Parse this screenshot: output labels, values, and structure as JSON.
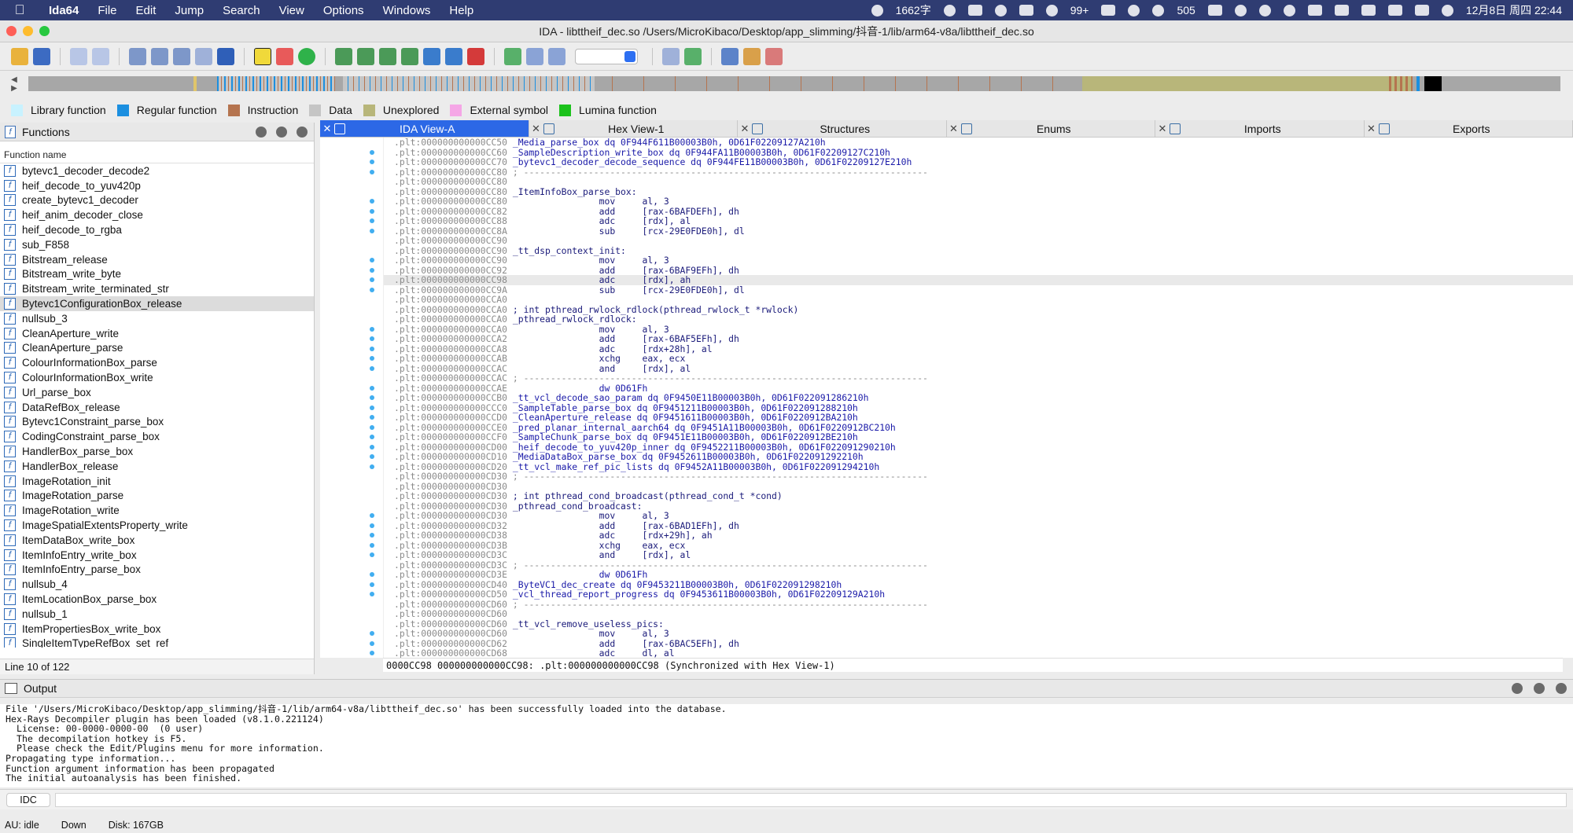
{
  "menubar": {
    "app": "Ida64",
    "items": [
      "File",
      "Edit",
      "Jump",
      "Search",
      "View",
      "Options",
      "Windows",
      "Help"
    ],
    "status": {
      "chars": "1662字",
      "notifications": "99+",
      "count": "505",
      "datetime": "12月8日 周四  22:44"
    }
  },
  "window": {
    "title": "IDA - libttheif_dec.so /Users/MicroKibaco/Desktop/app_slimming/抖音-1/lib/arm64-v8a/libttheif_dec.so"
  },
  "legend": [
    {
      "label": "Library function",
      "color": "#c8f2ff"
    },
    {
      "label": "Regular function",
      "color": "#1b8fe0"
    },
    {
      "label": "Instruction",
      "color": "#b5744f"
    },
    {
      "label": "Data",
      "color": "#c5c5c5"
    },
    {
      "label": "Unexplored",
      "color": "#b8b67a"
    },
    {
      "label": "External symbol",
      "color": "#f5a6e6"
    },
    {
      "label": "Lumina function",
      "color": "#1cc21c"
    }
  ],
  "functions": {
    "title": "Functions",
    "column": "Function name",
    "items": [
      "bytevc1_decoder_decode2",
      "heif_decode_to_yuv420p",
      "create_bytevc1_decoder",
      "heif_anim_decoder_close",
      "heif_decode_to_rgba",
      "sub_F858",
      "Bitstream_release",
      "Bitstream_write_byte",
      "Bitstream_write_terminated_str",
      "Bytevc1ConfigurationBox_release",
      "nullsub_3",
      "CleanAperture_write",
      "CleanAperture_parse",
      "ColourInformationBox_parse",
      "ColourInformationBox_write",
      "Url_parse_box",
      "DataRefBox_release",
      "Bytevc1Constraint_parse_box",
      "CodingConstraint_parse_box",
      "HandlerBox_parse_box",
      "HandlerBox_release",
      "ImageRotation_init",
      "ImageRotation_parse",
      "ImageRotation_write",
      "ImageSpatialExtentsProperty_write",
      "ItemDataBox_write_box",
      "ItemInfoEntry_write_box",
      "ItemInfoEntry_parse_box",
      "nullsub_4",
      "ItemLocationBox_parse_box",
      "nullsub_1",
      "ItemPropertiesBox_write_box",
      "SingleItemTypeRefBox_set_ref"
    ],
    "selected_index": 9,
    "footer": "Line 10 of 122"
  },
  "tabs": [
    {
      "label": "IDA View-A",
      "active": true
    },
    {
      "label": "Hex View-1",
      "active": false
    },
    {
      "label": "Structures",
      "active": false
    },
    {
      "label": "Enums",
      "active": false
    },
    {
      "label": "Imports",
      "active": false
    },
    {
      "label": "Exports",
      "active": false
    }
  ],
  "disasm": {
    "current_line": 14,
    "dot_lines": [
      1,
      2,
      3,
      6,
      7,
      8,
      9,
      12,
      13,
      14,
      15,
      19,
      20,
      21,
      22,
      23,
      25,
      26,
      27,
      28,
      29,
      30,
      31,
      32,
      33,
      38,
      39,
      40,
      41,
      42,
      44,
      45,
      46,
      50,
      51,
      52
    ],
    "lines": [
      {
        "addr": ".plt:000000000000CC50",
        "text": " _Media_parse_box dq 0F944F611B00003B0h, 0D61F02209127A210h"
      },
      {
        "addr": ".plt:000000000000CC60",
        "text": " _SampleDescription_write_box dq 0F944FA11B00003B0h, 0D61F02209127C210h"
      },
      {
        "addr": ".plt:000000000000CC70",
        "text": " _bytevc1_decoder_decode_sequence dq 0F944FE11B00003B0h, 0D61F02209127E210h"
      },
      {
        "addr": ".plt:000000000000CC80",
        "text": " ; ---------------------------------------------------------------------------"
      },
      {
        "addr": ".plt:000000000000CC80",
        "text": ""
      },
      {
        "addr": ".plt:000000000000CC80",
        "text": " _ItemInfoBox_parse_box:"
      },
      {
        "addr": ".plt:000000000000CC80",
        "text": "                 mov     al, 3"
      },
      {
        "addr": ".plt:000000000000CC82",
        "text": "                 add     [rax-6BAFDEFh], dh"
      },
      {
        "addr": ".plt:000000000000CC88",
        "text": "                 adc     [rdx], al"
      },
      {
        "addr": ".plt:000000000000CC8A",
        "text": "                 sub     [rcx-29E0FDE0h], dl"
      },
      {
        "addr": ".plt:000000000000CC90",
        "text": ""
      },
      {
        "addr": ".plt:000000000000CC90",
        "text": " _tt_dsp_context_init:"
      },
      {
        "addr": ".plt:000000000000CC90",
        "text": "                 mov     al, 3"
      },
      {
        "addr": ".plt:000000000000CC92",
        "text": "                 add     [rax-6BAF9EFh], dh"
      },
      {
        "addr": ".plt:000000000000CC98",
        "text": "                 adc     [rdx], ah"
      },
      {
        "addr": ".plt:000000000000CC9A",
        "text": "                 sub     [rcx-29E0FDE0h], dl"
      },
      {
        "addr": ".plt:000000000000CCA0",
        "text": ""
      },
      {
        "addr": ".plt:000000000000CCA0",
        "text": " ; int pthread_rwlock_rdlock(pthread_rwlock_t *rwlock)"
      },
      {
        "addr": ".plt:000000000000CCA0",
        "text": " _pthread_rwlock_rdlock:"
      },
      {
        "addr": ".plt:000000000000CCA0",
        "text": "                 mov     al, 3"
      },
      {
        "addr": ".plt:000000000000CCA2",
        "text": "                 add     [rax-6BAF5EFh], dh"
      },
      {
        "addr": ".plt:000000000000CCA8",
        "text": "                 adc     [rdx+28h], al"
      },
      {
        "addr": ".plt:000000000000CCAB",
        "text": "                 xchg    eax, ecx"
      },
      {
        "addr": ".plt:000000000000CCAC",
        "text": "                 and     [rdx], al"
      },
      {
        "addr": ".plt:000000000000CCAC",
        "text": " ; ---------------------------------------------------------------------------"
      },
      {
        "addr": ".plt:000000000000CCAE",
        "text": "                 dw 0D61Fh"
      },
      {
        "addr": ".plt:000000000000CCB0",
        "text": " _tt_vcl_decode_sao_param dq 0F9450E11B00003B0h, 0D61F022091286210h"
      },
      {
        "addr": ".plt:000000000000CCC0",
        "text": " _SampleTable_parse_box dq 0F9451211B00003B0h, 0D61F022091288210h"
      },
      {
        "addr": ".plt:000000000000CCD0",
        "text": " _CleanAperture_release dq 0F9451611B00003B0h, 0D61F0220912BA210h"
      },
      {
        "addr": ".plt:000000000000CCE0",
        "text": " _pred_planar_internal_aarch64 dq 0F9451A11B00003B0h, 0D61F0220912BC210h"
      },
      {
        "addr": ".plt:000000000000CCF0",
        "text": " _SampleChunk_parse_box dq 0F9451E11B00003B0h, 0D61F0220912BE210h"
      },
      {
        "addr": ".plt:000000000000CD00",
        "text": " _heif_decode_to_yuv420p_inner dq 0F9452211B00003B0h, 0D61F022091290210h"
      },
      {
        "addr": ".plt:000000000000CD10",
        "text": " _MediaDataBox_parse_box dq 0F9452611B00003B0h, 0D61F022091292210h"
      },
      {
        "addr": ".plt:000000000000CD20",
        "text": " _tt_vcl_make_ref_pic_lists dq 0F9452A11B00003B0h, 0D61F022091294210h"
      },
      {
        "addr": ".plt:000000000000CD30",
        "text": " ; ---------------------------------------------------------------------------"
      },
      {
        "addr": ".plt:000000000000CD30",
        "text": ""
      },
      {
        "addr": ".plt:000000000000CD30",
        "text": " ; int pthread_cond_broadcast(pthread_cond_t *cond)"
      },
      {
        "addr": ".plt:000000000000CD30",
        "text": " _pthread_cond_broadcast:"
      },
      {
        "addr": ".plt:000000000000CD30",
        "text": "                 mov     al, 3"
      },
      {
        "addr": ".plt:000000000000CD32",
        "text": "                 add     [rax-6BAD1EFh], dh"
      },
      {
        "addr": ".plt:000000000000CD38",
        "text": "                 adc     [rdx+29h], ah"
      },
      {
        "addr": ".plt:000000000000CD3B",
        "text": "                 xchg    eax, ecx"
      },
      {
        "addr": ".plt:000000000000CD3C",
        "text": "                 and     [rdx], al"
      },
      {
        "addr": ".plt:000000000000CD3C",
        "text": " ; ---------------------------------------------------------------------------"
      },
      {
        "addr": ".plt:000000000000CD3E",
        "text": "                 dw 0D61Fh"
      },
      {
        "addr": ".plt:000000000000CD40",
        "text": " _ByteVC1_dec_create dq 0F9453211B00003B0h, 0D61F022091298210h"
      },
      {
        "addr": ".plt:000000000000CD50",
        "text": " _vcl_thread_report_progress dq 0F9453611B00003B0h, 0D61F02209129A210h"
      },
      {
        "addr": ".plt:000000000000CD60",
        "text": " ; ---------------------------------------------------------------------------"
      },
      {
        "addr": ".plt:000000000000CD60",
        "text": ""
      },
      {
        "addr": ".plt:000000000000CD60",
        "text": " _tt_vcl_remove_useless_pics:"
      },
      {
        "addr": ".plt:000000000000CD60",
        "text": "                 mov     al, 3"
      },
      {
        "addr": ".plt:000000000000CD62",
        "text": "                 add     [rax-6BAC5EFh], dh"
      },
      {
        "addr": ".plt:000000000000CD68",
        "text": "                 adc     dl, al"
      }
    ],
    "status": "0000CC98 000000000000CC98: .plt:000000000000CC98 (Synchronized with Hex View-1)"
  },
  "output": {
    "title": "Output",
    "lines": [
      "File '/Users/MicroKibaco/Desktop/app_slimming/抖音-1/lib/arm64-v8a/libttheif_dec.so' has been successfully loaded into the database.",
      "Hex-Rays Decompiler plugin has been loaded (v8.1.0.221124)",
      "  License: 00-0000-0000-00  (0 user)",
      "  The decompilation hotkey is F5.",
      "  Please check the Edit/Plugins menu for more information.",
      "Propagating type information...",
      "Function argument information has been propagated",
      "The initial autoanalysis has been finished."
    ],
    "idc_label": "IDC"
  },
  "statusbar": {
    "au": "AU:",
    "state": "idle",
    "direction": "Down",
    "disk": "Disk: 167GB"
  }
}
